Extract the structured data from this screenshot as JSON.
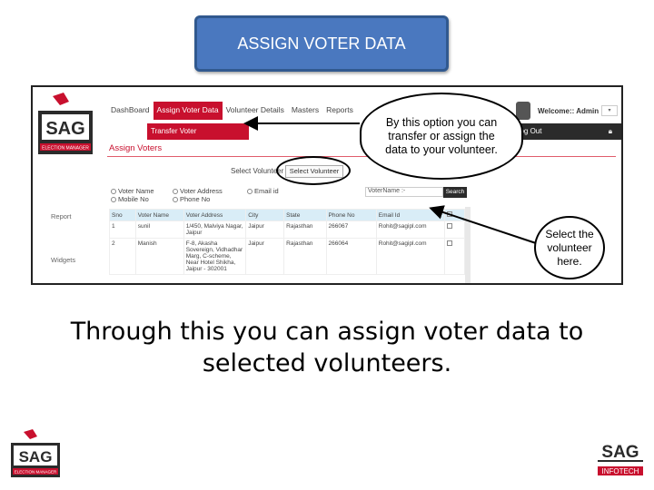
{
  "slide": {
    "title": "ASSIGN VOTER DATA",
    "main_text": "Through this you can assign  voter data to selected volunteers.",
    "callout_top": "By this option you can transfer or assign the data to your volunteer.",
    "callout_side": "Select the volunteer here."
  },
  "app": {
    "logo_text": "SAG",
    "logo_sub": "ELECTION MANAGER",
    "nav": [
      "DashBoard",
      "Assign Voter Data",
      "Volunteer Details",
      "Masters",
      "Reports"
    ],
    "submenu": "Transfer Voter",
    "page_title": "Assign Voters",
    "select_label": "Select Volunteer",
    "select_button": "Select Volunteer",
    "radio_options": [
      "Voter Name",
      "Voter Address",
      "Email id",
      "Mobile No",
      "Phone No"
    ],
    "votername_label": "VoterName :-",
    "search_button": "Search",
    "side_report": "Report",
    "side_widgets": "Widgets",
    "welcome": "Welcome:: Admin",
    "logout": "Log Out",
    "table": {
      "headers": [
        "Sno",
        "Voter Name",
        "Voter Address",
        "City",
        "State",
        "Phone No",
        "Email Id",
        ""
      ],
      "rows": [
        [
          "1",
          "sunil",
          "1/450, Malviya Nagar, Jaipur",
          "Jaipur",
          "Rajasthan",
          "266067",
          "Rohit@sagipl.com",
          ""
        ],
        [
          "2",
          "Manish",
          "F-8, Akasha Sovereign, Vidhadhar Marg, C-scheme, Near Hotel Shikha, Jaipur - 302001",
          "Jaipur",
          "Rajasthan",
          "266064",
          "Rohit@sagipl.com",
          ""
        ]
      ]
    }
  },
  "corp_logo": {
    "top": "SAG",
    "bottom": "INFOTECH"
  },
  "colors": {
    "title_bg": "#4a78bf",
    "brand_red": "#c8102e",
    "header_dark": "#2b2b2b"
  }
}
